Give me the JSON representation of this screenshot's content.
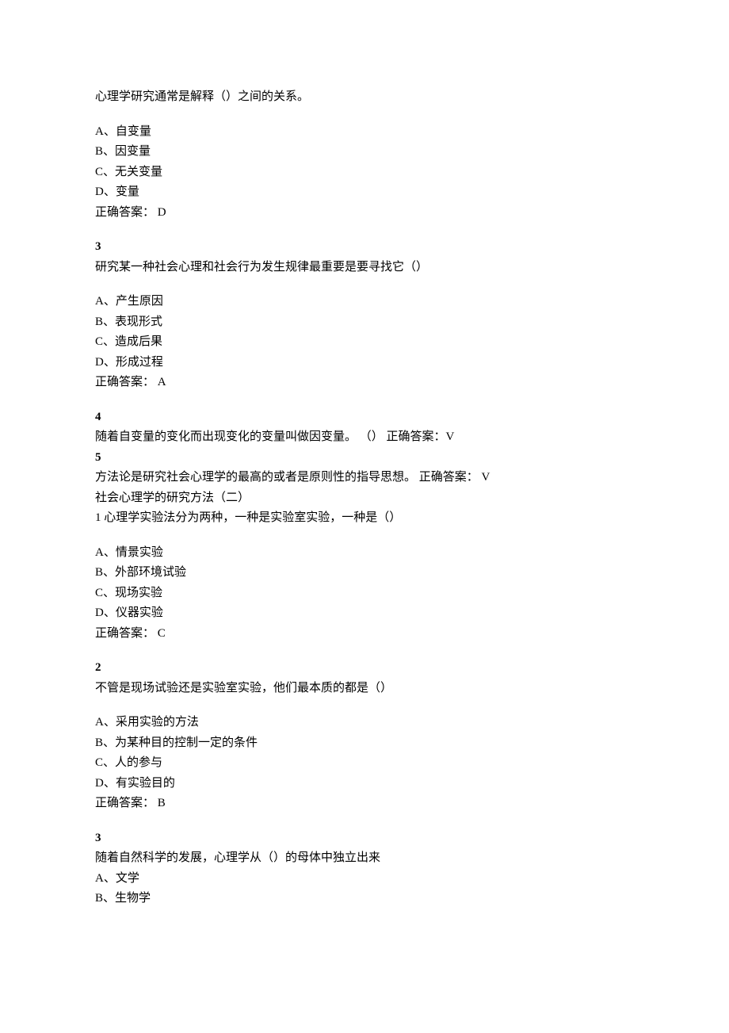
{
  "q2": {
    "stem": "心理学研究通常是解释（）之间的关系。",
    "optA": "A、自变量",
    "optB": "B、因变量",
    "optC": "C、无关变量",
    "optD": "D、变量",
    "ans": "正确答案： D"
  },
  "q3": {
    "num": "3",
    "stem": "研究某一种社会心理和社会行为发生规律最重要是要寻找它（）",
    "optA": "A、产生原因",
    "optB": "B、表现形式",
    "optC": "C、造成后果",
    "optD": "D、形成过程",
    "ans": "正确答案： A"
  },
  "q4": {
    "num": "4",
    "line": "随着自变量的变化而出现变化的变量叫做因变量。 （） 正确答案：V"
  },
  "q5": {
    "num": "5",
    "line1": "方法论是研究社会心理学的最高的或者是原则性的指导思想。 正确答案： V",
    "line2": "社会心理学的研究方法（二）",
    "line3": "1 心理学实验法分为两种，一种是实验室实验，一种是（）"
  },
  "q6": {
    "optA": "A、情景实验",
    "optB": "B、外部环境试验",
    "optC": "C、现场实验",
    "optD": "D、仪器实验",
    "ans": "正确答案： C"
  },
  "q7": {
    "num": "2",
    "stem": "不管是现场试验还是实验室实验，他们最本质的都是（）",
    "optA": "A、采用实验的方法",
    "optB": "B、为某种目的控制一定的条件",
    "optC": "C、人的参与",
    "optD": "D、有实验目的",
    "ans": "正确答案： B"
  },
  "q8": {
    "num": "3",
    "stem": "随着自然科学的发展，心理学从（）的母体中独立出来",
    "optA": "A、文学",
    "optB": "B、生物学"
  }
}
